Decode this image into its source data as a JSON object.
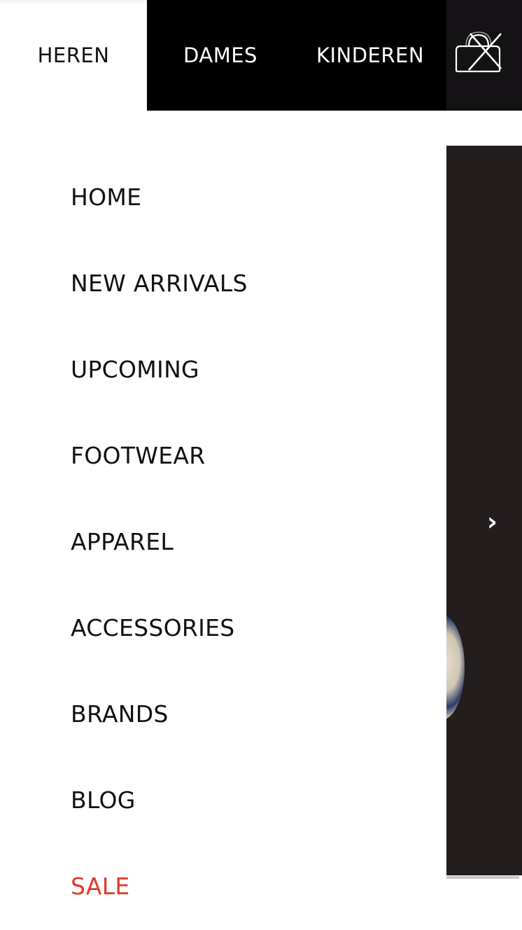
{
  "tabs": [
    {
      "label": "HEREN",
      "active": true
    },
    {
      "label": "DAMES",
      "active": false
    },
    {
      "label": "KINDEREN",
      "active": false
    }
  ],
  "menu": {
    "items": [
      {
        "label": "HOME"
      },
      {
        "label": "NEW ARRIVALS"
      },
      {
        "label": "UPCOMING"
      },
      {
        "label": "FOOTWEAR"
      },
      {
        "label": "APPAREL"
      },
      {
        "label": "ACCESSORIES"
      },
      {
        "label": "BRANDS"
      },
      {
        "label": "BLOG"
      },
      {
        "label": "SALE",
        "highlight": true
      }
    ]
  },
  "hero": {
    "next_arrow": "›"
  },
  "icons": {
    "close": "close-icon (crossed-out bag)"
  },
  "colors": {
    "tab_bar": "#000000",
    "active_tab": "#ffffff",
    "sale": "#e03a2a",
    "text": "#111111",
    "hero_bg": "#241d1e"
  }
}
